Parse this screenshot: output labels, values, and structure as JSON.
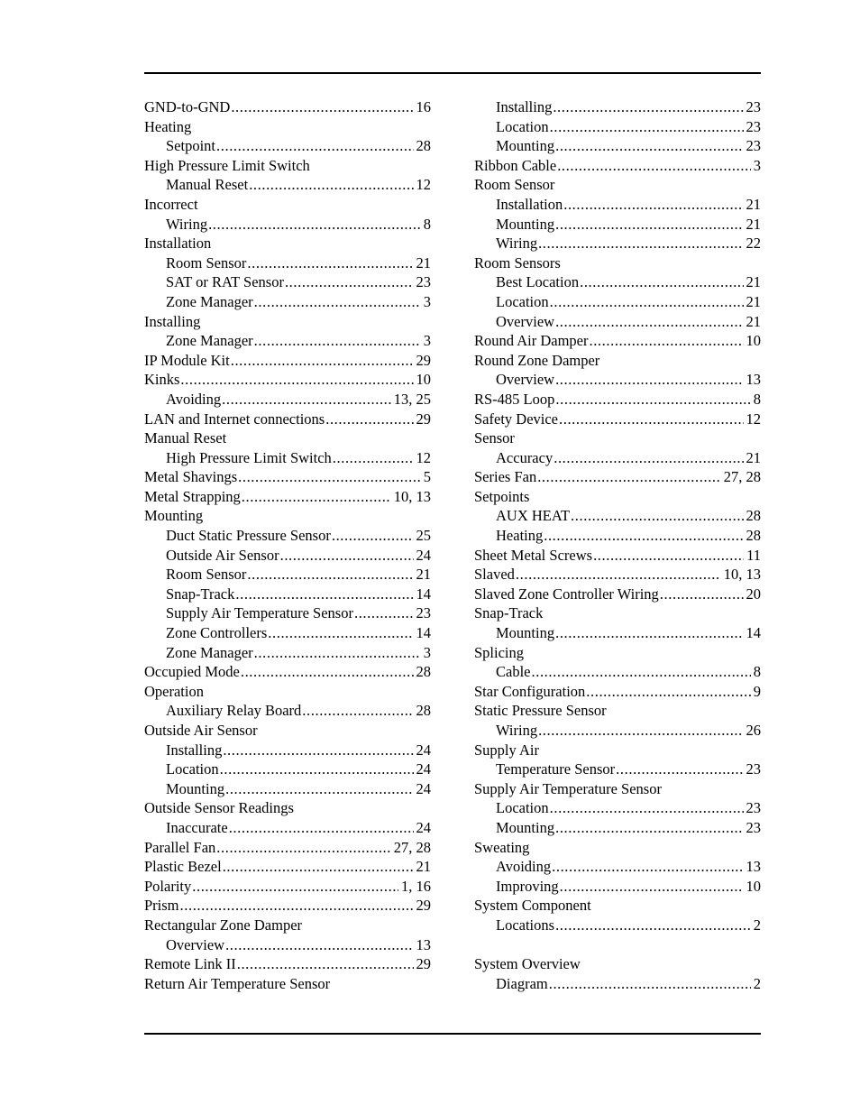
{
  "document": {
    "type": "index",
    "columns": [
      {
        "id": "left-column",
        "entries": [
          {
            "level": 0,
            "label": "GND-to-GND",
            "page": "16"
          },
          {
            "level": 0,
            "label": "Heating",
            "page": ""
          },
          {
            "level": 1,
            "label": "Setpoint",
            "page": "28"
          },
          {
            "level": 0,
            "label": "High Pressure Limit Switch",
            "page": ""
          },
          {
            "level": 1,
            "label": "Manual Reset",
            "page": "12"
          },
          {
            "level": 0,
            "label": "Incorrect",
            "page": ""
          },
          {
            "level": 1,
            "label": "Wiring",
            "page": "8"
          },
          {
            "level": 0,
            "label": "Installation",
            "page": ""
          },
          {
            "level": 1,
            "label": "Room Sensor",
            "page": "21"
          },
          {
            "level": 1,
            "label": "SAT or RAT Sensor",
            "page": "23"
          },
          {
            "level": 1,
            "label": "Zone Manager",
            "page": "3"
          },
          {
            "level": 0,
            "label": "Installing",
            "page": ""
          },
          {
            "level": 1,
            "label": "Zone Manager",
            "page": "3"
          },
          {
            "level": 0,
            "label": "IP Module Kit",
            "page": "29"
          },
          {
            "level": 0,
            "label": "Kinks",
            "page": "10"
          },
          {
            "level": 1,
            "label": "Avoiding",
            "page": "13, 25"
          },
          {
            "level": 0,
            "label": "LAN and Internet connections",
            "page": "29"
          },
          {
            "level": 0,
            "label": "Manual Reset",
            "page": ""
          },
          {
            "level": 1,
            "label": "High Pressure Limit Switch",
            "page": "12"
          },
          {
            "level": 0,
            "label": "Metal Shavings",
            "page": "5"
          },
          {
            "level": 0,
            "label": "Metal Strapping",
            "page": "10, 13"
          },
          {
            "level": 0,
            "label": "Mounting",
            "page": ""
          },
          {
            "level": 1,
            "label": "Duct Static Pressure Sensor",
            "page": "25"
          },
          {
            "level": 1,
            "label": "Outside Air Sensor",
            "page": "24"
          },
          {
            "level": 1,
            "label": "Room Sensor",
            "page": "21"
          },
          {
            "level": 1,
            "label": "Snap-Track",
            "page": "14"
          },
          {
            "level": 1,
            "label": "Supply Air Temperature Sensor",
            "page": "23"
          },
          {
            "level": 1,
            "label": "Zone Controllers",
            "page": "14"
          },
          {
            "level": 1,
            "label": "Zone Manager",
            "page": "3"
          },
          {
            "level": 0,
            "label": "Occupied Mode",
            "page": "28"
          },
          {
            "level": 0,
            "label": "Operation",
            "page": ""
          },
          {
            "level": 1,
            "label": "Auxiliary Relay Board",
            "page": "28"
          },
          {
            "level": 0,
            "label": "Outside Air Sensor",
            "page": ""
          },
          {
            "level": 1,
            "label": "Installing",
            "page": "24"
          },
          {
            "level": 1,
            "label": "Location",
            "page": "24"
          },
          {
            "level": 1,
            "label": "Mounting",
            "page": "24"
          },
          {
            "level": 0,
            "label": "Outside Sensor Readings",
            "page": ""
          },
          {
            "level": 1,
            "label": "Inaccurate",
            "page": "24"
          },
          {
            "level": 0,
            "label": "Parallel Fan",
            "page": "27, 28"
          },
          {
            "level": 0,
            "label": "Plastic Bezel",
            "page": "21"
          },
          {
            "level": 0,
            "label": "Polarity",
            "page": "1, 16"
          },
          {
            "level": 0,
            "label": "Prism",
            "page": "29"
          },
          {
            "level": 0,
            "label": "Rectangular Zone Damper",
            "page": ""
          },
          {
            "level": 1,
            "label": "Overview",
            "page": "13"
          },
          {
            "level": 0,
            "label": "Remote Link II",
            "page": "29"
          },
          {
            "level": 0,
            "label": "Return Air Temperature Sensor",
            "page": ""
          }
        ]
      },
      {
        "id": "right-column",
        "entries": [
          {
            "level": 1,
            "label": "Installing",
            "page": "23"
          },
          {
            "level": 1,
            "label": "Location",
            "page": "23"
          },
          {
            "level": 1,
            "label": "Mounting",
            "page": "23"
          },
          {
            "level": 0,
            "label": "Ribbon Cable",
            "page": "3"
          },
          {
            "level": 0,
            "label": "Room Sensor",
            "page": ""
          },
          {
            "level": 1,
            "label": "Installation",
            "page": "21"
          },
          {
            "level": 1,
            "label": "Mounting",
            "page": "21"
          },
          {
            "level": 1,
            "label": "Wiring",
            "page": "22"
          },
          {
            "level": 0,
            "label": "Room Sensors",
            "page": ""
          },
          {
            "level": 1,
            "label": "Best Location",
            "page": "21"
          },
          {
            "level": 1,
            "label": "Location",
            "page": "21"
          },
          {
            "level": 1,
            "label": "Overview",
            "page": "21"
          },
          {
            "level": 0,
            "label": "Round Air Damper",
            "page": "10"
          },
          {
            "level": 0,
            "label": "Round Zone Damper",
            "page": ""
          },
          {
            "level": 1,
            "label": "Overview",
            "page": "13"
          },
          {
            "level": 0,
            "label": "RS-485 Loop",
            "page": "8"
          },
          {
            "level": 0,
            "label": "Safety Device",
            "page": "12"
          },
          {
            "level": 0,
            "label": "Sensor",
            "page": ""
          },
          {
            "level": 1,
            "label": "Accuracy",
            "page": "21"
          },
          {
            "level": 0,
            "label": "Series Fan",
            "page": "27, 28"
          },
          {
            "level": 0,
            "label": "Setpoints",
            "page": ""
          },
          {
            "level": 1,
            "label": "AUX HEAT",
            "page": "28"
          },
          {
            "level": 1,
            "label": "Heating",
            "page": "28"
          },
          {
            "level": 0,
            "label": "Sheet Metal Screws",
            "page": "11"
          },
          {
            "level": 0,
            "label": "Slaved",
            "page": "10, 13"
          },
          {
            "level": 0,
            "label": "Slaved Zone Controller Wiring",
            "page": "20"
          },
          {
            "level": 0,
            "label": "Snap-Track",
            "page": ""
          },
          {
            "level": 1,
            "label": "Mounting",
            "page": "14"
          },
          {
            "level": 0,
            "label": "Splicing",
            "page": ""
          },
          {
            "level": 1,
            "label": "Cable",
            "page": "8"
          },
          {
            "level": 0,
            "label": "Star Configuration",
            "page": "9"
          },
          {
            "level": 0,
            "label": "Static Pressure Sensor",
            "page": ""
          },
          {
            "level": 1,
            "label": "Wiring",
            "page": "26"
          },
          {
            "level": 0,
            "label": "Supply Air",
            "page": ""
          },
          {
            "level": 1,
            "label": "Temperature Sensor",
            "page": "23"
          },
          {
            "level": 0,
            "label": "Supply Air Temperature Sensor",
            "page": ""
          },
          {
            "level": 1,
            "label": "Location",
            "page": "23"
          },
          {
            "level": 1,
            "label": "Mounting",
            "page": "23"
          },
          {
            "level": 0,
            "label": "Sweating",
            "page": ""
          },
          {
            "level": 1,
            "label": "Avoiding",
            "page": "13"
          },
          {
            "level": 1,
            "label": "Improving",
            "page": "10"
          },
          {
            "level": 0,
            "label": "System Component",
            "page": ""
          },
          {
            "level": 1,
            "label": "Locations",
            "page": "2"
          },
          {
            "level": -1,
            "label": "",
            "page": ""
          },
          {
            "level": 0,
            "label": "System Overview",
            "page": ""
          },
          {
            "level": 1,
            "label": "Diagram",
            "page": "2"
          }
        ]
      }
    ]
  }
}
